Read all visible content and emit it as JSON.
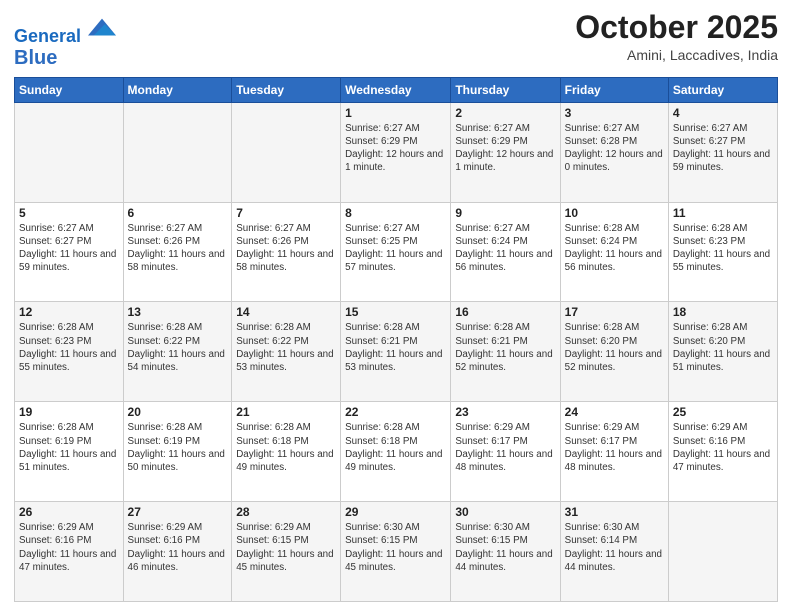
{
  "header": {
    "logo_line1": "General",
    "logo_line2": "Blue",
    "month": "October 2025",
    "location": "Amini, Laccadives, India"
  },
  "weekdays": [
    "Sunday",
    "Monday",
    "Tuesday",
    "Wednesday",
    "Thursday",
    "Friday",
    "Saturday"
  ],
  "weeks": [
    [
      {
        "day": "",
        "sunrise": "",
        "sunset": "",
        "daylight": ""
      },
      {
        "day": "",
        "sunrise": "",
        "sunset": "",
        "daylight": ""
      },
      {
        "day": "",
        "sunrise": "",
        "sunset": "",
        "daylight": ""
      },
      {
        "day": "1",
        "sunrise": "Sunrise: 6:27 AM",
        "sunset": "Sunset: 6:29 PM",
        "daylight": "Daylight: 12 hours and 1 minute."
      },
      {
        "day": "2",
        "sunrise": "Sunrise: 6:27 AM",
        "sunset": "Sunset: 6:29 PM",
        "daylight": "Daylight: 12 hours and 1 minute."
      },
      {
        "day": "3",
        "sunrise": "Sunrise: 6:27 AM",
        "sunset": "Sunset: 6:28 PM",
        "daylight": "Daylight: 12 hours and 0 minutes."
      },
      {
        "day": "4",
        "sunrise": "Sunrise: 6:27 AM",
        "sunset": "Sunset: 6:27 PM",
        "daylight": "Daylight: 11 hours and 59 minutes."
      }
    ],
    [
      {
        "day": "5",
        "sunrise": "Sunrise: 6:27 AM",
        "sunset": "Sunset: 6:27 PM",
        "daylight": "Daylight: 11 hours and 59 minutes."
      },
      {
        "day": "6",
        "sunrise": "Sunrise: 6:27 AM",
        "sunset": "Sunset: 6:26 PM",
        "daylight": "Daylight: 11 hours and 58 minutes."
      },
      {
        "day": "7",
        "sunrise": "Sunrise: 6:27 AM",
        "sunset": "Sunset: 6:26 PM",
        "daylight": "Daylight: 11 hours and 58 minutes."
      },
      {
        "day": "8",
        "sunrise": "Sunrise: 6:27 AM",
        "sunset": "Sunset: 6:25 PM",
        "daylight": "Daylight: 11 hours and 57 minutes."
      },
      {
        "day": "9",
        "sunrise": "Sunrise: 6:27 AM",
        "sunset": "Sunset: 6:24 PM",
        "daylight": "Daylight: 11 hours and 56 minutes."
      },
      {
        "day": "10",
        "sunrise": "Sunrise: 6:28 AM",
        "sunset": "Sunset: 6:24 PM",
        "daylight": "Daylight: 11 hours and 56 minutes."
      },
      {
        "day": "11",
        "sunrise": "Sunrise: 6:28 AM",
        "sunset": "Sunset: 6:23 PM",
        "daylight": "Daylight: 11 hours and 55 minutes."
      }
    ],
    [
      {
        "day": "12",
        "sunrise": "Sunrise: 6:28 AM",
        "sunset": "Sunset: 6:23 PM",
        "daylight": "Daylight: 11 hours and 55 minutes."
      },
      {
        "day": "13",
        "sunrise": "Sunrise: 6:28 AM",
        "sunset": "Sunset: 6:22 PM",
        "daylight": "Daylight: 11 hours and 54 minutes."
      },
      {
        "day": "14",
        "sunrise": "Sunrise: 6:28 AM",
        "sunset": "Sunset: 6:22 PM",
        "daylight": "Daylight: 11 hours and 53 minutes."
      },
      {
        "day": "15",
        "sunrise": "Sunrise: 6:28 AM",
        "sunset": "Sunset: 6:21 PM",
        "daylight": "Daylight: 11 hours and 53 minutes."
      },
      {
        "day": "16",
        "sunrise": "Sunrise: 6:28 AM",
        "sunset": "Sunset: 6:21 PM",
        "daylight": "Daylight: 11 hours and 52 minutes."
      },
      {
        "day": "17",
        "sunrise": "Sunrise: 6:28 AM",
        "sunset": "Sunset: 6:20 PM",
        "daylight": "Daylight: 11 hours and 52 minutes."
      },
      {
        "day": "18",
        "sunrise": "Sunrise: 6:28 AM",
        "sunset": "Sunset: 6:20 PM",
        "daylight": "Daylight: 11 hours and 51 minutes."
      }
    ],
    [
      {
        "day": "19",
        "sunrise": "Sunrise: 6:28 AM",
        "sunset": "Sunset: 6:19 PM",
        "daylight": "Daylight: 11 hours and 51 minutes."
      },
      {
        "day": "20",
        "sunrise": "Sunrise: 6:28 AM",
        "sunset": "Sunset: 6:19 PM",
        "daylight": "Daylight: 11 hours and 50 minutes."
      },
      {
        "day": "21",
        "sunrise": "Sunrise: 6:28 AM",
        "sunset": "Sunset: 6:18 PM",
        "daylight": "Daylight: 11 hours and 49 minutes."
      },
      {
        "day": "22",
        "sunrise": "Sunrise: 6:28 AM",
        "sunset": "Sunset: 6:18 PM",
        "daylight": "Daylight: 11 hours and 49 minutes."
      },
      {
        "day": "23",
        "sunrise": "Sunrise: 6:29 AM",
        "sunset": "Sunset: 6:17 PM",
        "daylight": "Daylight: 11 hours and 48 minutes."
      },
      {
        "day": "24",
        "sunrise": "Sunrise: 6:29 AM",
        "sunset": "Sunset: 6:17 PM",
        "daylight": "Daylight: 11 hours and 48 minutes."
      },
      {
        "day": "25",
        "sunrise": "Sunrise: 6:29 AM",
        "sunset": "Sunset: 6:16 PM",
        "daylight": "Daylight: 11 hours and 47 minutes."
      }
    ],
    [
      {
        "day": "26",
        "sunrise": "Sunrise: 6:29 AM",
        "sunset": "Sunset: 6:16 PM",
        "daylight": "Daylight: 11 hours and 47 minutes."
      },
      {
        "day": "27",
        "sunrise": "Sunrise: 6:29 AM",
        "sunset": "Sunset: 6:16 PM",
        "daylight": "Daylight: 11 hours and 46 minutes."
      },
      {
        "day": "28",
        "sunrise": "Sunrise: 6:29 AM",
        "sunset": "Sunset: 6:15 PM",
        "daylight": "Daylight: 11 hours and 45 minutes."
      },
      {
        "day": "29",
        "sunrise": "Sunrise: 6:30 AM",
        "sunset": "Sunset: 6:15 PM",
        "daylight": "Daylight: 11 hours and 45 minutes."
      },
      {
        "day": "30",
        "sunrise": "Sunrise: 6:30 AM",
        "sunset": "Sunset: 6:15 PM",
        "daylight": "Daylight: 11 hours and 44 minutes."
      },
      {
        "day": "31",
        "sunrise": "Sunrise: 6:30 AM",
        "sunset": "Sunset: 6:14 PM",
        "daylight": "Daylight: 11 hours and 44 minutes."
      },
      {
        "day": "",
        "sunrise": "",
        "sunset": "",
        "daylight": ""
      }
    ]
  ]
}
